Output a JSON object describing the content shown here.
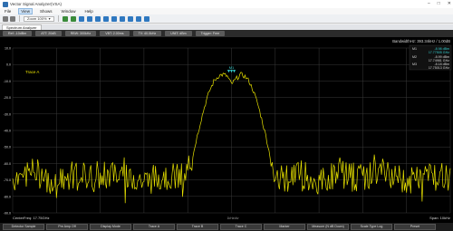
{
  "window": {
    "title": "Vector Signal Analyzer(VSA)",
    "buttons": [
      "–",
      "□",
      "✕"
    ]
  },
  "menu": [
    "File",
    "View",
    "Shows",
    "Window",
    "Help"
  ],
  "toolbar": {
    "zoom_label": "Zoom 100%",
    "zoom_caret": "▾",
    "buttons": [
      {
        "name": "back-arrow-icon",
        "color": "#3a8b3a"
      },
      {
        "name": "forward-arrow-icon",
        "color": "#3a8b3a"
      },
      {
        "name": "up-arrow-icon",
        "color": "#2f78c0"
      },
      {
        "name": "down-arrow-icon",
        "color": "#2f78c0"
      },
      {
        "name": "single-icon",
        "color": "#2f78c0"
      },
      {
        "name": "continuous-icon",
        "color": "#2f78c0"
      },
      {
        "name": "pause-icon",
        "color": "#2f78c0"
      },
      {
        "name": "record-icon",
        "color": "#2f78c0"
      },
      {
        "name": "marker-icon",
        "color": "#2f78c0"
      },
      {
        "name": "peak-icon",
        "color": "#2f78c0"
      },
      {
        "name": "settings-icon",
        "color": "#2f78c0"
      }
    ]
  },
  "doc_tab": "Spectrum Analyzer",
  "setting_tabs": [
    "Ref: -10dBm",
    "ATT: 20dB",
    "RBW: 300kHz",
    "VBT: 2.00ms",
    "TV: 40.0kHz",
    "UNIT: dBm",
    "Trigger: Free"
  ],
  "plot": {
    "readout": "BandwidthHz: 393.34kHz / 1.00dB",
    "trace_label": "Trace A",
    "y_ticks": [
      "10.0",
      "0.0",
      "-10.0",
      "-20.0",
      "-30.0",
      "-40.0",
      "-50.0",
      "-60.0",
      "-70.0",
      "-80.0",
      "-90.0"
    ],
    "center_freq": "CenterFreq: 17.75GHz",
    "span": "Span: 10kHz",
    "x_mid_label": "1kHz/div",
    "marker_flag": "M1",
    "marker_table": [
      {
        "id": "M1",
        "value": "-8.98 dBm",
        "freq": "17.77505 GHz"
      },
      {
        "id": "M2",
        "value": "-8.99 dBm",
        "freq": "17.74981 GHz"
      },
      {
        "id": "M3",
        "value": "-8.18 dBm",
        "freq": "17.75013 GHz"
      }
    ],
    "colors": {
      "trace": "#e8e200",
      "grid": "#3b3b3b",
      "text": "#d8d8d8",
      "marker": "#35d0d0"
    }
  },
  "chart_data": {
    "type": "line",
    "title": "",
    "xlabel": "",
    "ylabel": "",
    "ylim": [
      -90,
      10
    ],
    "series": [
      {
        "name": "Trace A",
        "x": [
          0,
          5,
          10,
          15,
          20,
          25,
          30,
          35,
          38,
          40,
          41,
          42,
          43,
          44,
          45,
          46,
          47,
          48,
          49,
          50,
          51,
          52,
          53,
          54,
          55,
          56,
          57,
          58,
          59,
          60,
          62,
          65,
          70,
          75,
          80,
          85,
          90,
          95,
          100
        ],
        "values": [
          -69,
          -65,
          -72,
          -66,
          -70,
          -64,
          -71,
          -67,
          -69,
          -66,
          -58,
          -45,
          -34,
          -24,
          -16,
          -10,
          -7,
          -6,
          -7,
          -12,
          -9,
          -6,
          -7,
          -10,
          -16,
          -24,
          -34,
          -45,
          -58,
          -66,
          -70,
          -65,
          -71,
          -66,
          -69,
          -64,
          -72,
          -67,
          -69
        ]
      }
    ]
  },
  "softkeys": [
    "Detector Sample",
    "Pre Amp Off",
    "Display Mode",
    "Trace A",
    "Trace B",
    "Trace C",
    "Marker",
    "Measure (N dB Down)",
    "Scale Type Log",
    "Preset"
  ]
}
